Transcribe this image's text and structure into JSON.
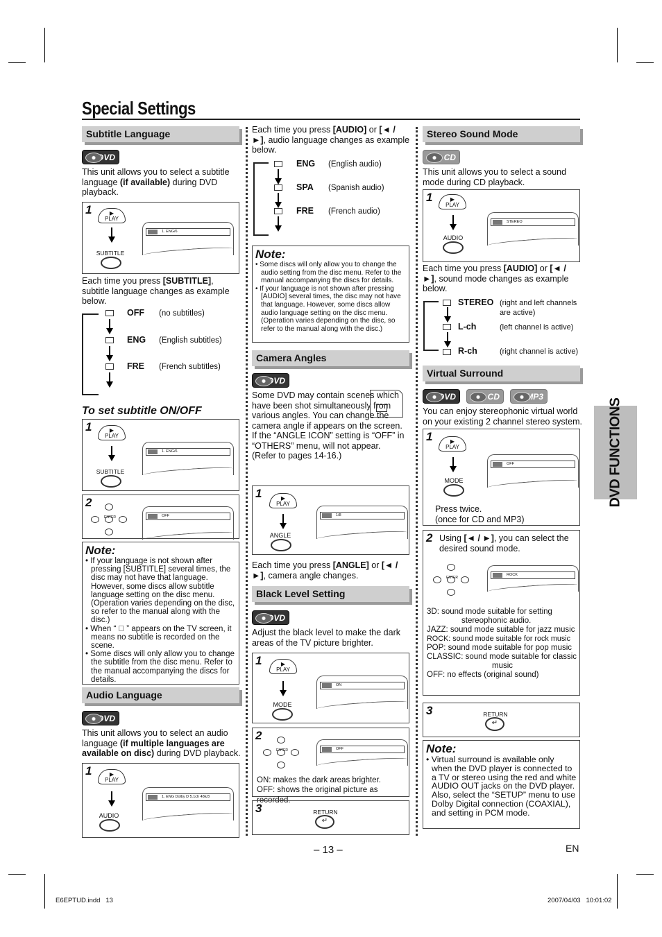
{
  "page": {
    "title": "Special Settings",
    "page_number": "– 13 –",
    "lang": "EN",
    "side_tab": "DVD FUNCTIONS",
    "footer_file": "E6EPTUD.indd   13",
    "footer_date": "2007/04/03   10:01:02"
  },
  "badges": {
    "dvd": "DVD",
    "cd": "CD",
    "mp3": "MP3"
  },
  "remote": {
    "play": "PLAY",
    "enter": "ENTER",
    "subtitle": "SUBTITLE",
    "audio": "AUDIO",
    "angle": "ANGLE",
    "mode": "MODE",
    "return": "RETURN"
  },
  "subtitle": {
    "header": "Subtitle Language",
    "intro_a": "This unit allows you to select a subtitle language ",
    "intro_b": "(if available)",
    "intro_c": " during DVD playback.",
    "step1_num": "1",
    "step1_osd": "1.  ENG/6",
    "each_a": "Each time you press ",
    "each_b": "[SUBTITLE]",
    "each_c": ", subtitle language changes as example below.",
    "list": [
      {
        "code": "OFF",
        "desc": "(no subtitles)"
      },
      {
        "code": "ENG",
        "desc": "(English subtitles)"
      },
      {
        "code": "FRE",
        "desc": "(French subtitles)"
      }
    ],
    "onoff_title": "To set subtitle ON/OFF",
    "onoff_step1_num": "1",
    "onoff_step1_osd": "1.  ENG/6",
    "onoff_step2_num": "2",
    "onoff_step2_osd": "OFF",
    "note_title": "Note:",
    "notes": [
      "• If your language is not shown after pressing [SUBTITLE] several times, the disc may not have that language. However, some discs allow subtitle language setting on the disc menu. (Operation varies depending on the disc, so refer to the manual along with the disc.)",
      "• When “ ⃠ ” appears on the TV screen, it means no subtitle is recorded on the scene.",
      "• Some discs will only allow you to change the subtitle from the disc menu. Refer to the manual accompanying the discs for details."
    ]
  },
  "audio": {
    "header": "Audio Language",
    "intro_a": "This unit allows you to select an audio language ",
    "intro_b": "(if multiple languages are available on disc)",
    "intro_c": " during DVD playback.",
    "step1_num": "1",
    "step1_osd": "1.  ENG  Dolby D  5.1ch  48k/3",
    "each_a": "Each time you press ",
    "each_b": "[AUDIO]",
    "each_c": " or ",
    "each_d": "[◄ / ►]",
    "each_e": ", audio language changes as example below.",
    "list": [
      {
        "code": "ENG",
        "desc": "(English audio)"
      },
      {
        "code": "SPA",
        "desc": "(Spanish audio)"
      },
      {
        "code": "FRE",
        "desc": "(French audio)"
      }
    ],
    "note_title": "Note:",
    "notes": [
      "• Some discs will only allow you to change the audio setting from the disc menu. Refer to the manual accompanying the discs for details.",
      "• If your language is not shown after pressing [AUDIO] several times, the disc may not have that language. However, some discs allow audio language setting on the disc menu. (Operation varies depending on the disc, so refer to the manual along with the disc.)"
    ]
  },
  "camera": {
    "header": "Camera Angles",
    "intro": "Some DVD may contain scenes which have been shot simultaneously from various angles. You can change the camera angle if      appears on the screen. If the “ANGLE ICON” setting is “OFF” in “OTHERS” menu,      will not appear. (Refer to pages 14-16.)",
    "step1_num": "1",
    "step1_osd": "1/8",
    "each_a": "Each time you press ",
    "each_b": "[ANGLE]",
    "each_c": " or ",
    "each_d": "[◄ / ►]",
    "each_e": ", camera angle changes."
  },
  "black": {
    "header": "Black Level Setting",
    "intro": "Adjust the black level to make the dark areas of the TV picture brighter.",
    "step1_num": "1",
    "step1_osd": "ON",
    "step2_num": "2",
    "step2_osd": "OFF",
    "on_text": "ON: makes the dark areas brighter.",
    "off_text": "OFF: shows the original picture as recorded.",
    "step3_num": "3"
  },
  "stereo": {
    "header": "Stereo Sound Mode",
    "intro": "This unit allows you to select a sound mode during CD playback.",
    "step1_num": "1",
    "step1_osd": "STEREO",
    "each_a": "Each time you press ",
    "each_b": "[AUDIO]",
    "each_c": " or ",
    "each_d": "[◄ / ►]",
    "each_e": ", sound mode changes as example below.",
    "list": [
      {
        "code": "STEREO",
        "desc": "(right and left channels are active)"
      },
      {
        "code": "L-ch",
        "desc": "(left channel is active)"
      },
      {
        "code": "R-ch",
        "desc": "(right channel is active)"
      }
    ]
  },
  "surround": {
    "header": "Virtual Surround",
    "intro": "You can enjoy stereophonic virtual world on your existing 2 channel stereo system.",
    "step1_num": "1",
    "step1_osd": "OFF",
    "press_twice": "Press twice.",
    "press_once": "(once for CD and MP3)",
    "step2_num": "2",
    "step2_a": "Using ",
    "step2_b": "[◄ / ►]",
    "step2_c": ", you can select the desired sound mode.",
    "step2_osd": "ROCK",
    "modes": [
      "3D: sound mode suitable for setting stereophonic audio.",
      "JAZZ: sound mode suitable for jazz music",
      "ROCK: sound mode suitable for rock music",
      "POP: sound mode suitable for pop music",
      "CLASSIC: sound mode suitable for classic music",
      "OFF: no effects (original sound)"
    ],
    "step3_num": "3",
    "note_title": "Note:",
    "notes": [
      "• Virtual surround is available only when the DVD player is connected to a TV or stereo using the red and white AUDIO OUT jacks on the DVD player. Also, select the “SETUP” menu to use Dolby Digital connection (COAXIAL), and setting in PCM mode."
    ]
  }
}
